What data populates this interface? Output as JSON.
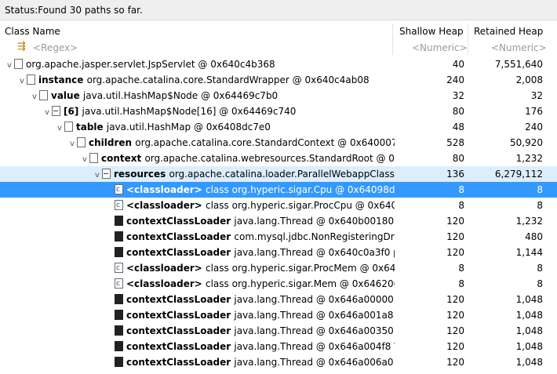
{
  "status": {
    "label": "Status:",
    "text": "Found 30 paths so far."
  },
  "columns": {
    "class_name": "Class Name",
    "shallow": "Shallow Heap",
    "retained": "Retained Heap"
  },
  "filters": {
    "class": "<Regex>",
    "shallow": "<Numeric>",
    "retained": "<Numeric>"
  },
  "rows": [
    {
      "field": "",
      "rest": "org.apache.jasper.servlet.JspServlet @ 0x640c4b368",
      "shallow": "40",
      "retained": "7,551,640"
    },
    {
      "field": "instance",
      "rest": "org.apache.catalina.core.StandardWrapper @ 0x640c4ab08",
      "shallow": "240",
      "retained": "2,008"
    },
    {
      "field": "value",
      "rest": "java.util.HashMap$Node @ 0x64469c7b0",
      "shallow": "32",
      "retained": "32"
    },
    {
      "field": "[6]",
      "rest": "java.util.HashMap$Node[16] @ 0x64469c740",
      "shallow": "80",
      "retained": "176"
    },
    {
      "field": "table",
      "rest": "java.util.HashMap @ 0x6408dc7e0",
      "shallow": "48",
      "retained": "240"
    },
    {
      "field": "children",
      "rest": "org.apache.catalina.core.StandardContext @ 0x640007b",
      "shallow": "528",
      "retained": "50,920"
    },
    {
      "field": "context",
      "rest": "org.apache.catalina.webresources.StandardRoot @ 0x",
      "shallow": "80",
      "retained": "1,232"
    },
    {
      "field": "resources",
      "rest": "org.apache.catalina.loader.ParallelWebappClassL",
      "shallow": "136",
      "retained": "6,279,112"
    },
    {
      "field": "<classloader>",
      "rest": "class org.hyperic.sigar.Cpu @ 0x64098d1",
      "shallow": "8",
      "retained": "8"
    },
    {
      "field": "<classloader>",
      "rest": "class org.hyperic.sigar.ProcCpu @ 0x6409",
      "shallow": "8",
      "retained": "8"
    },
    {
      "field": "contextClassLoader",
      "rest": "java.lang.Thread @ 0x640b00180  \\u",
      "shallow": "120",
      "retained": "1,232"
    },
    {
      "field": "contextClassLoader",
      "rest": "com.mysql.jdbc.NonRegisteringDriv",
      "shallow": "120",
      "retained": "480"
    },
    {
      "field": "contextClassLoader",
      "rest": "java.lang.Thread @ 0x640c0a3f0  pc",
      "shallow": "120",
      "retained": "1,144"
    },
    {
      "field": "<classloader>",
      "rest": "class org.hyperic.sigar.ProcMem @ 0x646",
      "shallow": "8",
      "retained": "8"
    },
    {
      "field": "<classloader>",
      "rest": "class org.hyperic.sigar.Mem @ 0x646206f",
      "shallow": "8",
      "retained": "8"
    },
    {
      "field": "contextClassLoader",
      "rest": "java.lang.Thread @ 0x646a00000  \\u",
      "shallow": "120",
      "retained": "1,048"
    },
    {
      "field": "contextClassLoader",
      "rest": "java.lang.Thread @ 0x646a001a8  \\u",
      "shallow": "120",
      "retained": "1,048"
    },
    {
      "field": "contextClassLoader",
      "rest": "java.lang.Thread @ 0x646a00350  \\u",
      "shallow": "120",
      "retained": "1,048"
    },
    {
      "field": "contextClassLoader",
      "rest": "java.lang.Thread @ 0x646a004f8  \\u",
      "shallow": "120",
      "retained": "1,048"
    },
    {
      "field": "contextClassLoader",
      "rest": "java.lang.Thread @ 0x646a006a0  \\u",
      "shallow": "120",
      "retained": "1,048"
    }
  ]
}
